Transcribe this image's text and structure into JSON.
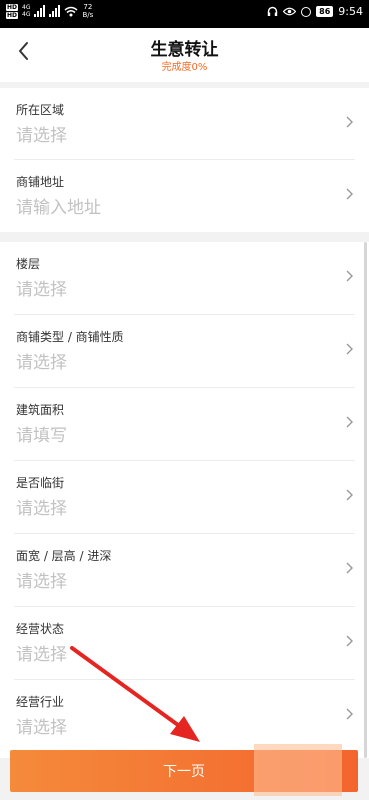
{
  "status_bar": {
    "network_labels": [
      "4G",
      "4G"
    ],
    "speed": "72",
    "speed_unit": "B/s",
    "battery": "86",
    "time": "9:54"
  },
  "header": {
    "title": "生意转让",
    "subtitle": "完成度0%"
  },
  "section1": {
    "items": [
      {
        "label": "所在区域",
        "value": "请选择"
      },
      {
        "label": "商铺地址",
        "value": "请输入地址"
      }
    ]
  },
  "section2": {
    "items": [
      {
        "label": "楼层",
        "value": "请选择"
      },
      {
        "label": "商铺类型 / 商铺性质",
        "value": "请选择"
      },
      {
        "label": "建筑面积",
        "value": "请填写"
      },
      {
        "label": "是否临街",
        "value": "请选择"
      },
      {
        "label": "面宽 / 层高 / 进深",
        "value": "请选择"
      },
      {
        "label": "经营状态",
        "value": "请选择"
      },
      {
        "label": "经营行业",
        "value": "请选择"
      }
    ]
  },
  "footer": {
    "next_label": "下一页"
  },
  "colors": {
    "accent": "#f26a23",
    "button_start": "#f58a3a",
    "button_end": "#f3652e",
    "annotation_arrow": "#e52521"
  },
  "icons": [
    "back-arrow-icon",
    "chevron-right-icon"
  ]
}
